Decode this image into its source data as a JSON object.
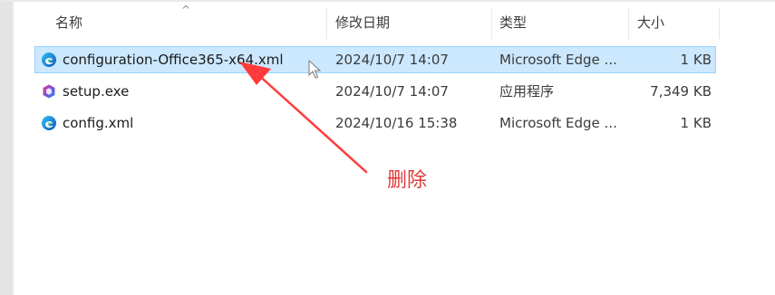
{
  "columns": {
    "name": "名称",
    "modified": "修改日期",
    "type": "类型",
    "size": "大小"
  },
  "files": [
    {
      "name": "configuration-Office365-x64.xml",
      "modified": "2024/10/7 14:07",
      "type": "Microsoft Edge ...",
      "size": "1 KB",
      "icon": "edge-icon",
      "selected": true
    },
    {
      "name": "setup.exe",
      "modified": "2024/10/7 14:07",
      "type": "应用程序",
      "size": "7,349 KB",
      "icon": "office-setup-icon",
      "selected": false
    },
    {
      "name": "config.xml",
      "modified": "2024/10/16 15:38",
      "type": "Microsoft Edge ...",
      "size": "1 KB",
      "icon": "edge-icon",
      "selected": false
    }
  ],
  "annotation": {
    "text": "删除",
    "color": "#e03a3a"
  },
  "colors": {
    "selection_bg": "#cce8ff",
    "selection_border": "#99d1ff",
    "arrow": "#ff3b3b"
  }
}
